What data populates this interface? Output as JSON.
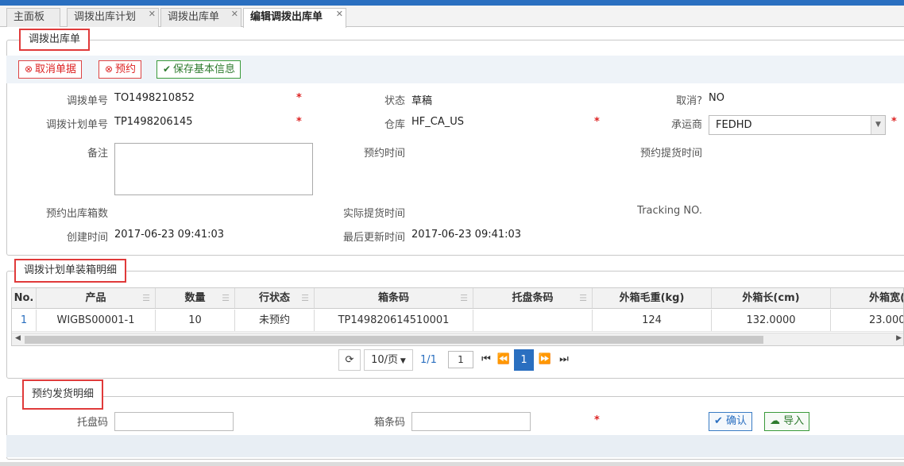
{
  "tabs": [
    {
      "label": "主面板",
      "closable": false
    },
    {
      "label": "调拨出库计划",
      "closable": true
    },
    {
      "label": "调拨出库单",
      "closable": true
    },
    {
      "label": "编辑调拨出库单",
      "closable": true,
      "active": true
    }
  ],
  "section1": {
    "title": "调拨出库单",
    "toolbar": {
      "cancel_label": "取消单据",
      "reserve_label": "预约",
      "save_label": "保存基本信息"
    },
    "fields": {
      "transfer_no": {
        "label": "调拨单号",
        "value": "TO1498210852"
      },
      "status": {
        "label": "状态",
        "value": "草稿"
      },
      "cancelled": {
        "label": "取消?",
        "value": "NO"
      },
      "plan_no": {
        "label": "调拨计划单号",
        "value": "TP1498206145"
      },
      "warehouse": {
        "label": "仓库",
        "value": "HF_CA_US"
      },
      "carrier": {
        "label": "承运商",
        "value": "FEDHD"
      },
      "remark": {
        "label": "备注",
        "value": ""
      },
      "reserve_time": {
        "label": "预约时间",
        "value": ""
      },
      "reserve_pickup_time": {
        "label": "预约提货时间",
        "value": ""
      },
      "reserve_box_count": {
        "label": "预约出库箱数",
        "value": ""
      },
      "actual_pickup_time": {
        "label": "实际提货时间",
        "value": ""
      },
      "tracking_no": {
        "label": "Tracking NO.",
        "value": ""
      },
      "created_time": {
        "label": "创建时间",
        "value": "2017-06-23 09:41:03"
      },
      "updated_time": {
        "label": "最后更新时间",
        "value": "2017-06-23 09:41:03"
      }
    },
    "required_mark": "*"
  },
  "section2": {
    "title": "调拨计划单装箱明细",
    "columns": [
      "No.",
      "产品",
      "数量",
      "行状态",
      "箱条码",
      "托盘条码",
      "外箱毛重(kg)",
      "外箱长(cm)",
      "外箱宽(c"
    ],
    "rows": [
      [
        "1",
        "WIGBS00001-1",
        "10",
        "未预约",
        "TP149820614510001",
        "",
        "124",
        "132.0000",
        "23.000"
      ]
    ],
    "pager": {
      "page_size": "10/页",
      "page_info": "1/1",
      "page_input": "1",
      "current_page": "1"
    }
  },
  "section3": {
    "title": "预约发货明细",
    "pallet_label": "托盘码",
    "box_label": "箱条码",
    "confirm_label": "确认",
    "import_label": "导入"
  }
}
